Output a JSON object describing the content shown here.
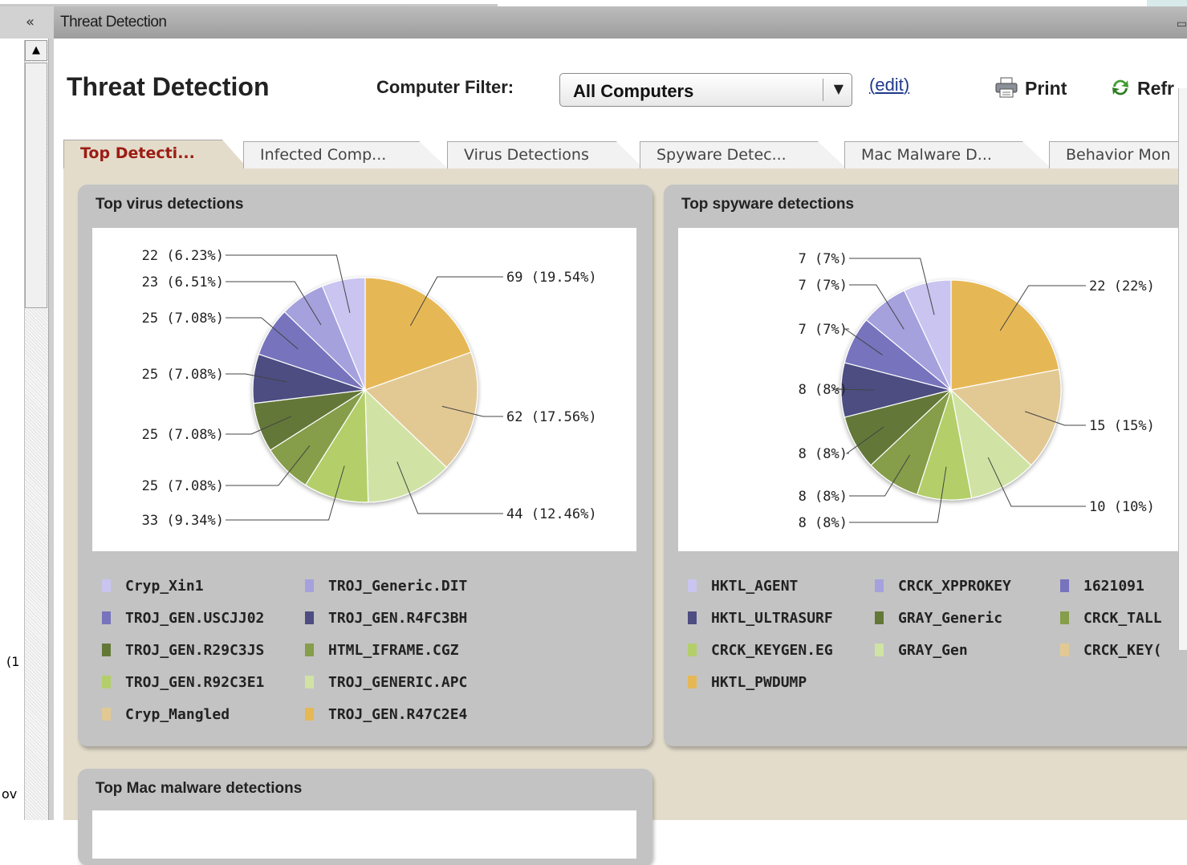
{
  "window": {
    "title": "Threat Detection",
    "collapse_label": "«"
  },
  "left_fragments": [
    "(1",
    "ov"
  ],
  "header": {
    "title": "Threat Detection",
    "filter_label": "Computer Filter:",
    "filter_value": "All Computers",
    "edit_open": "(",
    "edit_label": "edit",
    "edit_close": ")",
    "print_label": "Print",
    "refresh_label": "Refr"
  },
  "tabs": [
    "Top Detecti...",
    "Infected Comp...",
    "Virus Detections",
    "Spyware Detec...",
    "Mac Malware D...",
    "Behavior Mon"
  ],
  "colors": {
    "palette": [
      "#c9c4f0",
      "#a5a1dd",
      "#7773bd",
      "#4d4d82",
      "#637837",
      "#869d4a",
      "#b4cf6a",
      "#d0e3a4",
      "#e2c994",
      "#e6b855"
    ],
    "accent_tab": "#9b1c14",
    "card_bg": "#c3c3c3",
    "panel_bg": "#e3dccb"
  },
  "charts": {
    "virus_title": "Top virus detections",
    "spyware_title": "Top spyware detections",
    "mac_title": "Top Mac malware detections"
  },
  "chart_data": [
    {
      "type": "pie",
      "title": "Top virus detections",
      "slices": [
        {
          "label": "TROJ_GEN.R47C2E4",
          "value": 69,
          "display": "69 (19.54%)",
          "color": "#e6b855"
        },
        {
          "label": "Cryp_Mangled",
          "value": 62,
          "display": "62 (17.56%)",
          "color": "#e2c994"
        },
        {
          "label": "TROJ_GENERIC.APC",
          "value": 44,
          "display": "44 (12.46%)",
          "color": "#d0e3a4"
        },
        {
          "label": "TROJ_GEN.R92C3E1",
          "value": 33,
          "display": "33 (9.34%)",
          "color": "#b4cf6a"
        },
        {
          "label": "HTML_IFRAME.CGZ",
          "value": 25,
          "display": "25 (7.08%)",
          "color": "#869d4a"
        },
        {
          "label": "TROJ_GEN.R29C3JS",
          "value": 25,
          "display": "25 (7.08%)",
          "color": "#637837"
        },
        {
          "label": "TROJ_GEN.R4FC3BH",
          "value": 25,
          "display": "25 (7.08%)",
          "color": "#4d4d82"
        },
        {
          "label": "TROJ_GEN.USCJJ02",
          "value": 25,
          "display": "25 (7.08%)",
          "color": "#7773bd"
        },
        {
          "label": "TROJ_Generic.DIT",
          "value": 23,
          "display": "23 (6.51%)",
          "color": "#a5a1dd"
        },
        {
          "label": "Cryp_Xin1",
          "value": 22,
          "display": "22 (6.23%)",
          "color": "#c9c4f0"
        }
      ],
      "legend": [
        "Cryp_Xin1",
        "TROJ_Generic.DIT",
        "TROJ_GEN.USCJJ02",
        "TROJ_GEN.R4FC3BH",
        "TROJ_GEN.R29C3JS",
        "HTML_IFRAME.CGZ",
        "TROJ_GEN.R92C3E1",
        "TROJ_GENERIC.APC",
        "Cryp_Mangled",
        "TROJ_GEN.R47C2E4"
      ],
      "legend_colors": [
        "#c9c4f0",
        "#a5a1dd",
        "#7773bd",
        "#4d4d82",
        "#637837",
        "#869d4a",
        "#b4cf6a",
        "#d0e3a4",
        "#e2c994",
        "#e6b855"
      ]
    },
    {
      "type": "pie",
      "title": "Top spyware detections",
      "slices": [
        {
          "label": "HKTL_PWDUMP",
          "value": 22,
          "display": "22 (22%)",
          "color": "#e6b855"
        },
        {
          "label": "CRCK_KEYGEN",
          "value": 15,
          "display": "15 (15%)",
          "color": "#e2c994"
        },
        {
          "label": "GRAY_Gen",
          "value": 10,
          "display": "10 (10%)",
          "color": "#d0e3a4"
        },
        {
          "label": "CRCK_KEYGEN.EG",
          "value": 8,
          "display": "8 (8%)",
          "color": "#b4cf6a"
        },
        {
          "label": "CRCK_TALL",
          "value": 8,
          "display": "8 (8%)",
          "color": "#869d4a"
        },
        {
          "label": "GRAY_Generic",
          "value": 8,
          "display": "8 (8%)",
          "color": "#637837"
        },
        {
          "label": "HKTL_ULTRASURF",
          "value": 8,
          "display": "8 (8%)",
          "color": "#4d4d82"
        },
        {
          "label": "1621091",
          "value": 7,
          "display": "7 (7%)",
          "color": "#7773bd"
        },
        {
          "label": "CRCK_XPPROKEY",
          "value": 7,
          "display": "7 (7%)",
          "color": "#a5a1dd"
        },
        {
          "label": "HKTL_AGENT",
          "value": 7,
          "display": "7 (7%)",
          "color": "#c9c4f0"
        }
      ],
      "legend": [
        "HKTL_AGENT",
        "CRCK_XPPROKEY",
        "1621091",
        "HKTL_ULTRASURF",
        "GRAY_Generic",
        "CRCK_TALL",
        "CRCK_KEYGEN.EG",
        "GRAY_Gen",
        "CRCK_KEY(",
        "HKTL_PWDUMP"
      ],
      "legend_colors": [
        "#c9c4f0",
        "#a5a1dd",
        "#7773bd",
        "#4d4d82",
        "#637837",
        "#869d4a",
        "#b4cf6a",
        "#d0e3a4",
        "#e2c994",
        "#e6b855"
      ]
    }
  ]
}
